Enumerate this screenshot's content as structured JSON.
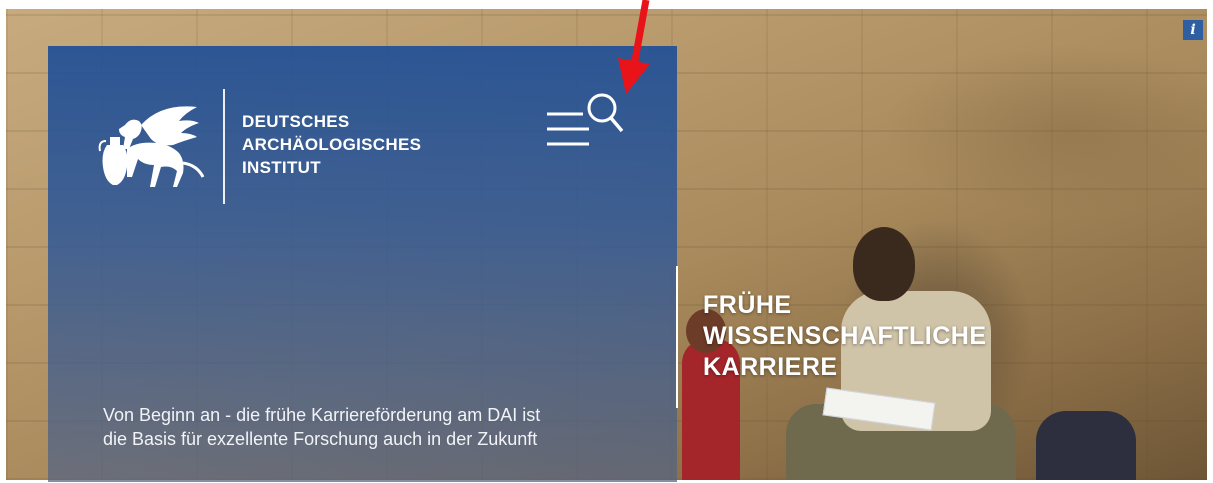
{
  "brand": {
    "lines": [
      "DEUTSCHES",
      "ARCHÄOLOGISCHES",
      "INSTITUT"
    ],
    "logo_icon": "griffin-logo-icon"
  },
  "header": {
    "menu_search_icon": "menu-search-icon"
  },
  "info_button": {
    "label": "i"
  },
  "hero": {
    "title_lines": [
      "FRÜHE",
      "WISSENSCHAFTLICHE",
      "KARRIERE"
    ],
    "lead_lines": [
      "Von Beginn an - die frühe Karriereförderung am DAI ist",
      "die Basis für exzellente Forschung auch in der Zukunft"
    ]
  },
  "annotation": {
    "arrow_color": "#e8141a"
  },
  "colors": {
    "panel_blue": "#2150a0",
    "text": "#ffffff"
  }
}
